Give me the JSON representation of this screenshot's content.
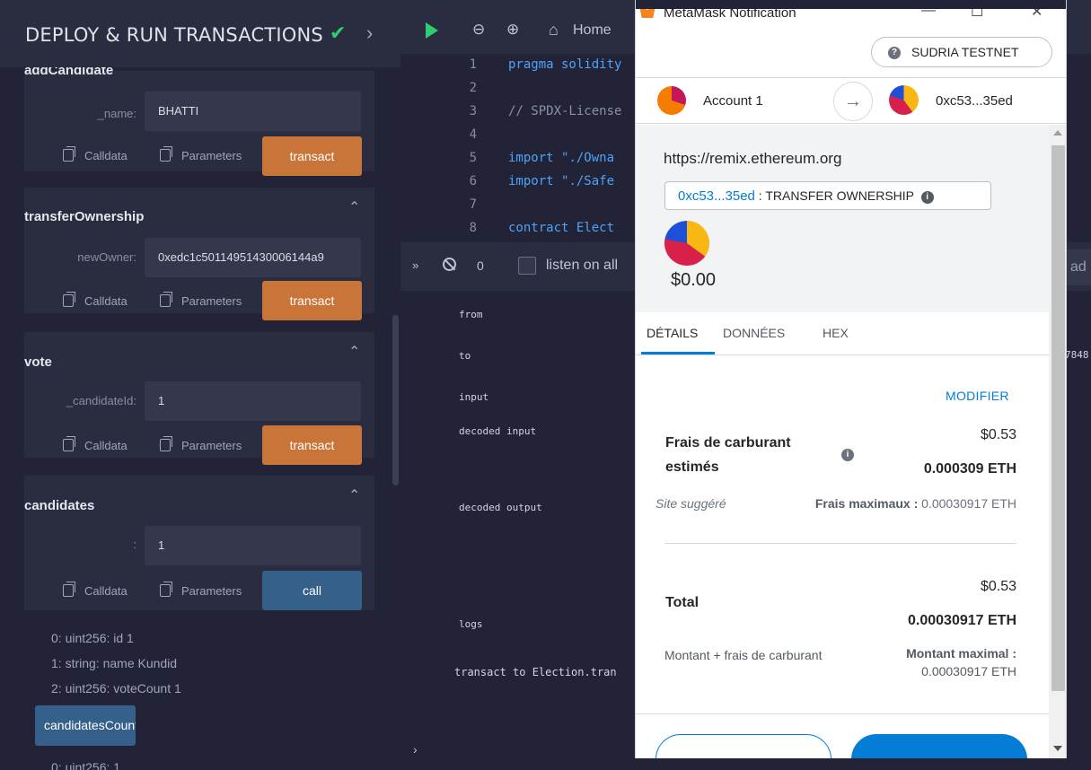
{
  "left_panel": {
    "title": "DEPLOY & RUN TRANSACTIONS",
    "clipped_function": "addCandidate",
    "add_candidate": {
      "param_label": "_name:",
      "param_value": "BHATTI",
      "action_label": "transact"
    },
    "transfer_ownership": {
      "title": "transferOwnership",
      "param_label": "newOwner:",
      "param_value": "0xedc1c50114951430006144a9",
      "action_label": "transact"
    },
    "vote": {
      "title": "vote",
      "param_label": "_candidateId:",
      "param_value": "1",
      "action_label": "transact"
    },
    "candidates": {
      "title": "candidates",
      "param_label": ":",
      "param_value": "1",
      "action_label": "call",
      "results": [
        "0: uint256: id 1",
        "1: string: name Kundid",
        "2: uint256: voteCount 1"
      ]
    },
    "candidates_count": {
      "label": "candidatesCount",
      "result": "0: uint256: 1"
    },
    "calldata_label": "Calldata",
    "parameters_label": "Parameters"
  },
  "editor": {
    "home_label": "Home",
    "code_lines": [
      {
        "n": "1",
        "t": "pragma solidity",
        "color": "#4fa3f7"
      },
      {
        "n": "2",
        "t": "",
        "color": "#c9c9d6"
      },
      {
        "n": "3",
        "t": "// SPDX-License",
        "color": "#8d8fa6"
      },
      {
        "n": "4",
        "t": "",
        "color": "#c9c9d6"
      },
      {
        "n": "5",
        "t": "import \"./Owna",
        "color": "#4fa3f7"
      },
      {
        "n": "6",
        "t": "import \"./Safe",
        "color": "#4fa3f7"
      },
      {
        "n": "7",
        "t": "",
        "color": "#c9c9d6"
      },
      {
        "n": "8",
        "t": "contract Elect",
        "color": "#4fa3f7"
      }
    ]
  },
  "terminal": {
    "count": "0",
    "listen_label": "listen on all",
    "search_text": "ad",
    "keys": [
      "from",
      "to",
      "input",
      "decoded input",
      "decoded output",
      "logs"
    ],
    "clipped_digits": "7848",
    "log_line": "transact to Election.tran"
  },
  "metamask": {
    "window_title": "MetaMask Notification",
    "network": "SUDRIA TESTNET",
    "from_account": "Account 1",
    "to_address": "0xc53...35ed",
    "origin": "https://remix.ethereum.org",
    "chip_address": "0xc53...35ed",
    "chip_function": ": TRANSFER OWNERSHIP",
    "amount": "$0.00",
    "tabs": [
      "DÉTAILS",
      "DONNÉES",
      "HEX"
    ],
    "modifier_label": "MODIFIER",
    "gas_label": "Frais de carburant estimés",
    "gas_fiat": "$0.53",
    "gas_eth": "0.000309 ETH",
    "site_suggested": "Site suggéré",
    "max_fee_label": "Frais maximaux :",
    "max_fee_value": "0.00030917 ETH",
    "total_label": "Total",
    "total_fiat": "$0.53",
    "total_eth": "0.00030917 ETH",
    "amount_fees_label": "Montant + frais de carburant",
    "max_amount_label": "Montant maximal :",
    "max_amount_value": "0.00030917 ETH"
  },
  "colors": {
    "transact": "#c97539",
    "call": "#35608a",
    "metamask_blue": "#037dd6",
    "success_green": "#2fcc71"
  }
}
